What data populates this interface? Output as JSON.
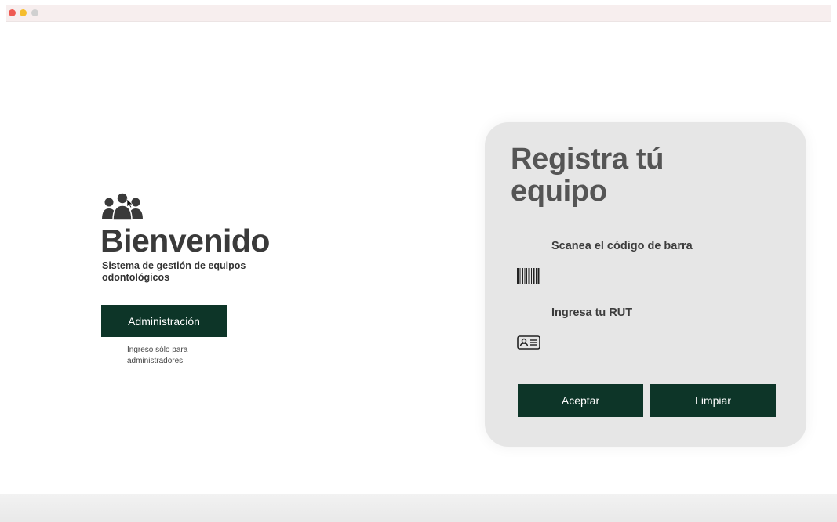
{
  "window": {
    "controls": [
      "close",
      "minimize",
      "zoom"
    ]
  },
  "left": {
    "icon": "users-group-icon",
    "title": "Bienvenido",
    "subtitle": "Sistema de gestión de equipos odontológicos",
    "admin_button": "Administración",
    "admin_note": "Ingreso sólo para administradores"
  },
  "card": {
    "title": "Registra tú equipo",
    "barcode": {
      "label": "Scanea el código de barra",
      "icon": "barcode-icon",
      "value": ""
    },
    "rut": {
      "label": "Ingresa tu RUT",
      "icon": "id-card-icon",
      "value": ""
    },
    "accept_button": "Aceptar",
    "clear_button": "Limpiar"
  },
  "colors": {
    "button": "#0d3528",
    "card": "#e6e6e6",
    "title_text": "#555555"
  }
}
